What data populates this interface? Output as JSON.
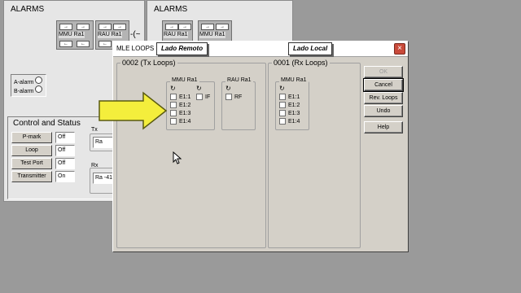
{
  "left_panel": {
    "title": "ALARMS",
    "equip1": "MMU Ra1",
    "equip2": "RAU Ra1",
    "alarm_a": "A-alarm",
    "alarm_b": "B-alarm",
    "control_title": "Control and Status",
    "buttons": [
      "P-mark",
      "Loop",
      "Test Port",
      "Transmitter"
    ],
    "values": [
      "Off",
      "Off",
      "Off",
      "On"
    ],
    "tx_label": "Tx",
    "tx_value": "Ra",
    "rx_label": "Rx",
    "rx_value": "Ra   -41"
  },
  "right_panel": {
    "title": "ALARMS",
    "equip1": "RAU Ra1",
    "equip2": "MMU Ra1"
  },
  "dialog": {
    "title": "MLE LOOPS",
    "tag_remote": "Lado Remoto",
    "tag_local": "Lado Local",
    "remote_group": "0002 (Tx Loops)",
    "local_group": "0001 (Rx Loops)",
    "remote_mmu": {
      "label": "MMU Ra1",
      "items": [
        "E1:1",
        "E1:2",
        "E1:3",
        "E1:4"
      ],
      "extra": "IF"
    },
    "remote_rau": {
      "label": "RAU Ra1",
      "items": [
        "RF"
      ]
    },
    "local_mmu": {
      "label": "MMU Ra1",
      "items": [
        "E1:1",
        "E1:2",
        "E1:3",
        "E1:4"
      ]
    },
    "buttons": {
      "ok": "OK",
      "cancel": "Cancel",
      "rev_loops": "Rev. Loops",
      "undo": "Undo",
      "help": "Help"
    }
  },
  "colors": {
    "desktop": "#9a9a9a",
    "arrow_fill": "#f4ee3c",
    "arrow_stroke": "#5a5a10",
    "dialog_titlebar": "#ffffff"
  }
}
